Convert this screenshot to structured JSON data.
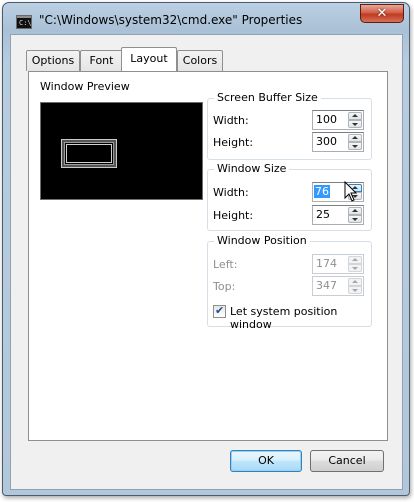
{
  "window": {
    "title": "\"C:\\Windows\\system32\\cmd.exe\" Properties",
    "close_glyph": "✕",
    "icon_text": "C:\\"
  },
  "tabs": [
    {
      "label": "Options",
      "active": false
    },
    {
      "label": "Font",
      "active": false
    },
    {
      "label": "Layout",
      "active": true
    },
    {
      "label": "Colors",
      "active": false
    }
  ],
  "preview": {
    "label": "Window Preview"
  },
  "screen_buffer": {
    "title": "Screen Buffer Size",
    "width_label": "Width:",
    "width_value": "100",
    "height_label": "Height:",
    "height_value": "300"
  },
  "window_size": {
    "title": "Window Size",
    "width_label": "Width:",
    "width_value": "76",
    "height_label": "Height:",
    "height_value": "25"
  },
  "window_position": {
    "title": "Window Position",
    "left_label": "Left:",
    "left_value": "174",
    "top_label": "Top:",
    "top_value": "347",
    "checkbox_label": "Let system position window",
    "checkbox_checked": true
  },
  "buttons": {
    "ok": "OK",
    "cancel": "Cancel"
  }
}
